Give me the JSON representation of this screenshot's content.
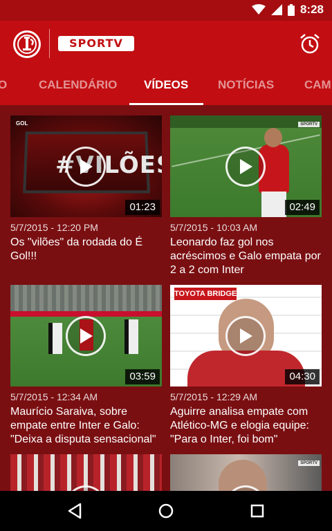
{
  "status_bar": {
    "time": "8:28",
    "icons": [
      "wifi-icon",
      "signal-icon",
      "battery-icon"
    ]
  },
  "app_bar": {
    "club_logo": "sc-internacional-crest",
    "partner_logo_text": "SPORTV",
    "action_icon": "alarm-clock-icon"
  },
  "tabs": [
    {
      "label": "O",
      "active": false
    },
    {
      "label": "CALENDÁRIO",
      "active": false
    },
    {
      "label": "VÍDEOS",
      "active": true
    },
    {
      "label": "NOTÍCIAS",
      "active": false
    },
    {
      "label": "CAM",
      "active": false
    }
  ],
  "videos": [
    {
      "thumb_text": "#VILÕES",
      "duration": "01:23",
      "date": "5/7/2015 - 12:20 PM",
      "title": "Os \"vilões\" da rodada do É Gol!!!"
    },
    {
      "duration": "02:49",
      "date": "5/7/2015 - 10:03 AM",
      "title": "Leonardo faz gol nos acréscimos e Galo empata por 2 a 2 com Inter"
    },
    {
      "duration": "03:59",
      "date": "5/7/2015 - 12:34 AM",
      "title": "Maurício Saraiva, sobre empate entre Inter e Galo: \"Deixa a disputa sensacional\""
    },
    {
      "thumb_text": "TOYOTA BRIDGESTONE VISA",
      "duration": "04:30",
      "date": "5/7/2015 - 12:29 AM",
      "title": "Aguirre analisa empate com Atlético-MG e elogia equipe: \"Para o Inter, foi bom\""
    }
  ],
  "nav_bar": {
    "back": "back-icon",
    "home": "home-icon",
    "recents": "recents-icon"
  },
  "colors": {
    "app_bar": "#c20e12",
    "status_bar": "#a50d10",
    "background": "#7a0f12"
  }
}
